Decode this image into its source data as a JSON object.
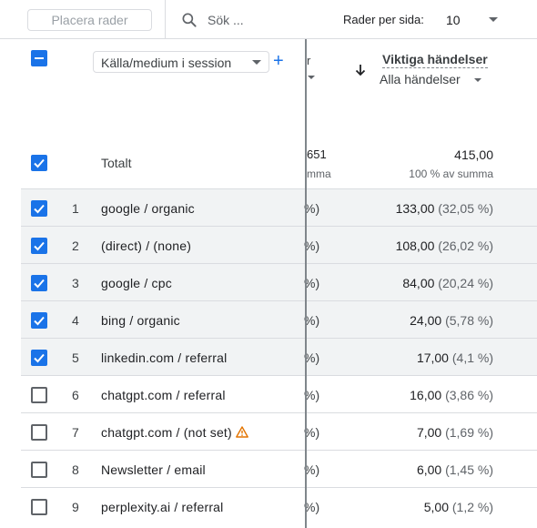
{
  "toolbar": {
    "plot_rows_label": "Placera rader",
    "search_placeholder": "Sök ...",
    "rows_per_page_label": "Rader per sida:",
    "rows_per_page_value": "10"
  },
  "header": {
    "dimension_label": "Källa/medium i session",
    "add_dimension": "+",
    "clipped_metric_fragment": "r",
    "metric_title": "Viktiga händelser",
    "metric_subtitle": "Alla händelser"
  },
  "totals": {
    "label": "Totalt",
    "clipped_value": "651",
    "clipped_sub": "mma",
    "value": "415,00",
    "sub": "100 % av summa"
  },
  "rows": [
    {
      "index": "1",
      "dimension": "google / organic",
      "clipped": "%)",
      "value": "133,00",
      "pct": "(32,05 %)",
      "checked": true,
      "warning": false
    },
    {
      "index": "2",
      "dimension": "(direct) / (none)",
      "clipped": "%)",
      "value": "108,00",
      "pct": "(26,02 %)",
      "checked": true,
      "warning": false
    },
    {
      "index": "3",
      "dimension": "google / cpc",
      "clipped": "%)",
      "value": "84,00",
      "pct": "(20,24 %)",
      "checked": true,
      "warning": false
    },
    {
      "index": "4",
      "dimension": "bing / organic",
      "clipped": "%)",
      "value": "24,00",
      "pct": "(5,78 %)",
      "checked": true,
      "warning": false
    },
    {
      "index": "5",
      "dimension": "linkedin.com / referral",
      "clipped": "%)",
      "value": "17,00",
      "pct": "(4,1 %)",
      "checked": true,
      "warning": false
    },
    {
      "index": "6",
      "dimension": "chatgpt.com / referral",
      "clipped": "%)",
      "value": "16,00",
      "pct": "(3,86 %)",
      "checked": false,
      "warning": false
    },
    {
      "index": "7",
      "dimension": "chatgpt.com / (not set)",
      "clipped": "%)",
      "value": "7,00",
      "pct": "(1,69 %)",
      "checked": false,
      "warning": true
    },
    {
      "index": "8",
      "dimension": "Newsletter / email",
      "clipped": "%)",
      "value": "6,00",
      "pct": "(1,45 %)",
      "checked": false,
      "warning": false
    },
    {
      "index": "9",
      "dimension": "perplexity.ai / referral",
      "clipped": "%)",
      "value": "5,00",
      "pct": "(1,2 %)",
      "checked": false,
      "warning": false
    }
  ],
  "colors": {
    "accent": "#1a73e8",
    "warning": "#e37400",
    "row_shade": "#f1f3f4"
  }
}
